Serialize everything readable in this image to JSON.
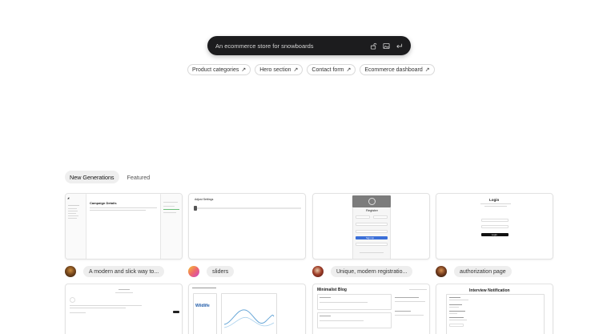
{
  "prompt": {
    "placeholder": "An ecommerce store for snowboards",
    "icons": [
      "unlock-icon",
      "image-icon",
      "enter-icon"
    ]
  },
  "suggestions": [
    {
      "label": "Product categories"
    },
    {
      "label": "Hero section"
    },
    {
      "label": "Contact form"
    },
    {
      "label": "Ecommerce dashboard"
    }
  ],
  "tabs": [
    {
      "label": "New Generations",
      "active": true
    },
    {
      "label": "Featured",
      "active": false
    }
  ],
  "generations": [
    {
      "title": "A modern and slick way to...",
      "avatar_colors": [
        "#3b2a1a",
        "#c98a3b"
      ]
    },
    {
      "title": "sliders",
      "avatar_colors": [
        "#f0c23a",
        "#d548c6"
      ]
    },
    {
      "title": "Unique, modern registratio...",
      "avatar_colors": [
        "#7a1f1f",
        "#e0c0a0"
      ]
    },
    {
      "title": "authorization page",
      "avatar_colors": [
        "#2a1a10",
        "#b8763a"
      ]
    }
  ],
  "previews": {
    "campaign_name": "Campaign Details",
    "slider_title": "Adjust Settings",
    "register_title": "Register",
    "register_button": "Sign Up",
    "login_title": "Login",
    "login_button": "Login",
    "blog_title": "Minimalist Blog",
    "notification_title": "Interview Notification",
    "wildlife_label": "Wildlife"
  }
}
